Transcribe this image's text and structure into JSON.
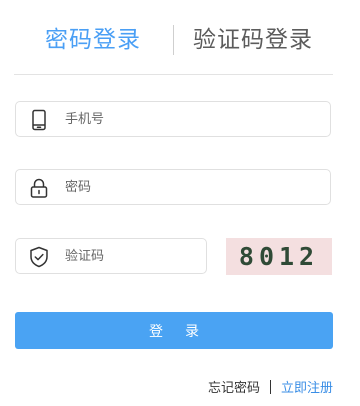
{
  "tabs": {
    "password_login": "密码登录",
    "sms_login": "验证码登录",
    "active": "password_login"
  },
  "fields": {
    "phone": {
      "placeholder": "手机号",
      "value": "",
      "icon": "mobile-phone-icon"
    },
    "password": {
      "placeholder": "密码",
      "value": "",
      "icon": "lock-icon"
    },
    "code": {
      "placeholder": "验证码",
      "value": "",
      "icon": "shield-check-icon"
    }
  },
  "captcha": {
    "text": "8012"
  },
  "login_button": {
    "label": "登录"
  },
  "links": {
    "forgot_password": "忘记密码",
    "register": "立即注册"
  },
  "colors": {
    "accent": "#4a9ff5",
    "button": "#4aa3f3",
    "link": "#3a8ee6",
    "captcha_bg": "#f4dfe0"
  }
}
